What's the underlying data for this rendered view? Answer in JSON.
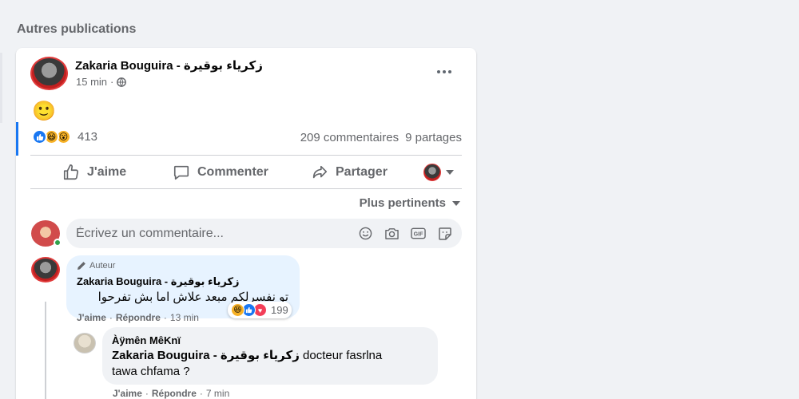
{
  "section": {
    "title": "Autres publications"
  },
  "post": {
    "author": "Zakaria Bouguira - زكرياء بوقيرة",
    "time": "15 min",
    "emoji": "🙂",
    "reactions_count": "413",
    "comments_count": "209 commentaires",
    "shares_count": "9 partages",
    "reaction_icons": [
      "like-reaction-icon",
      "haha-reaction-icon",
      "wow-reaction-icon"
    ]
  },
  "actions": {
    "like": "J'aime",
    "comment": "Commenter",
    "share": "Partager"
  },
  "sort": {
    "label": "Plus pertinents"
  },
  "composer": {
    "placeholder": "Écrivez un commentaire..."
  },
  "comments": [
    {
      "badge": "Auteur",
      "author": "Zakaria Bouguira - زكرياء بوقيرة",
      "text": "تو نفسرلكم مبعد علاش اما بش تفرحوا",
      "reactions_count": "199",
      "like": "J'aime",
      "reply": "Répondre",
      "time": "13 min"
    },
    {
      "author": "Àÿmên MêKnï",
      "mention": "Zakaria Bouguira - زكرياء بوقيرة",
      "text_after_mention": "docteur fasrlna",
      "text_line2": "tawa chfama ?",
      "like": "J'aime",
      "reply": "Répondre",
      "time": "7 min"
    }
  ],
  "colors": {
    "accent": "#1877f2",
    "text_secondary": "#65676b",
    "author_bubble": "#e7f3ff",
    "online": "#31a24c"
  }
}
